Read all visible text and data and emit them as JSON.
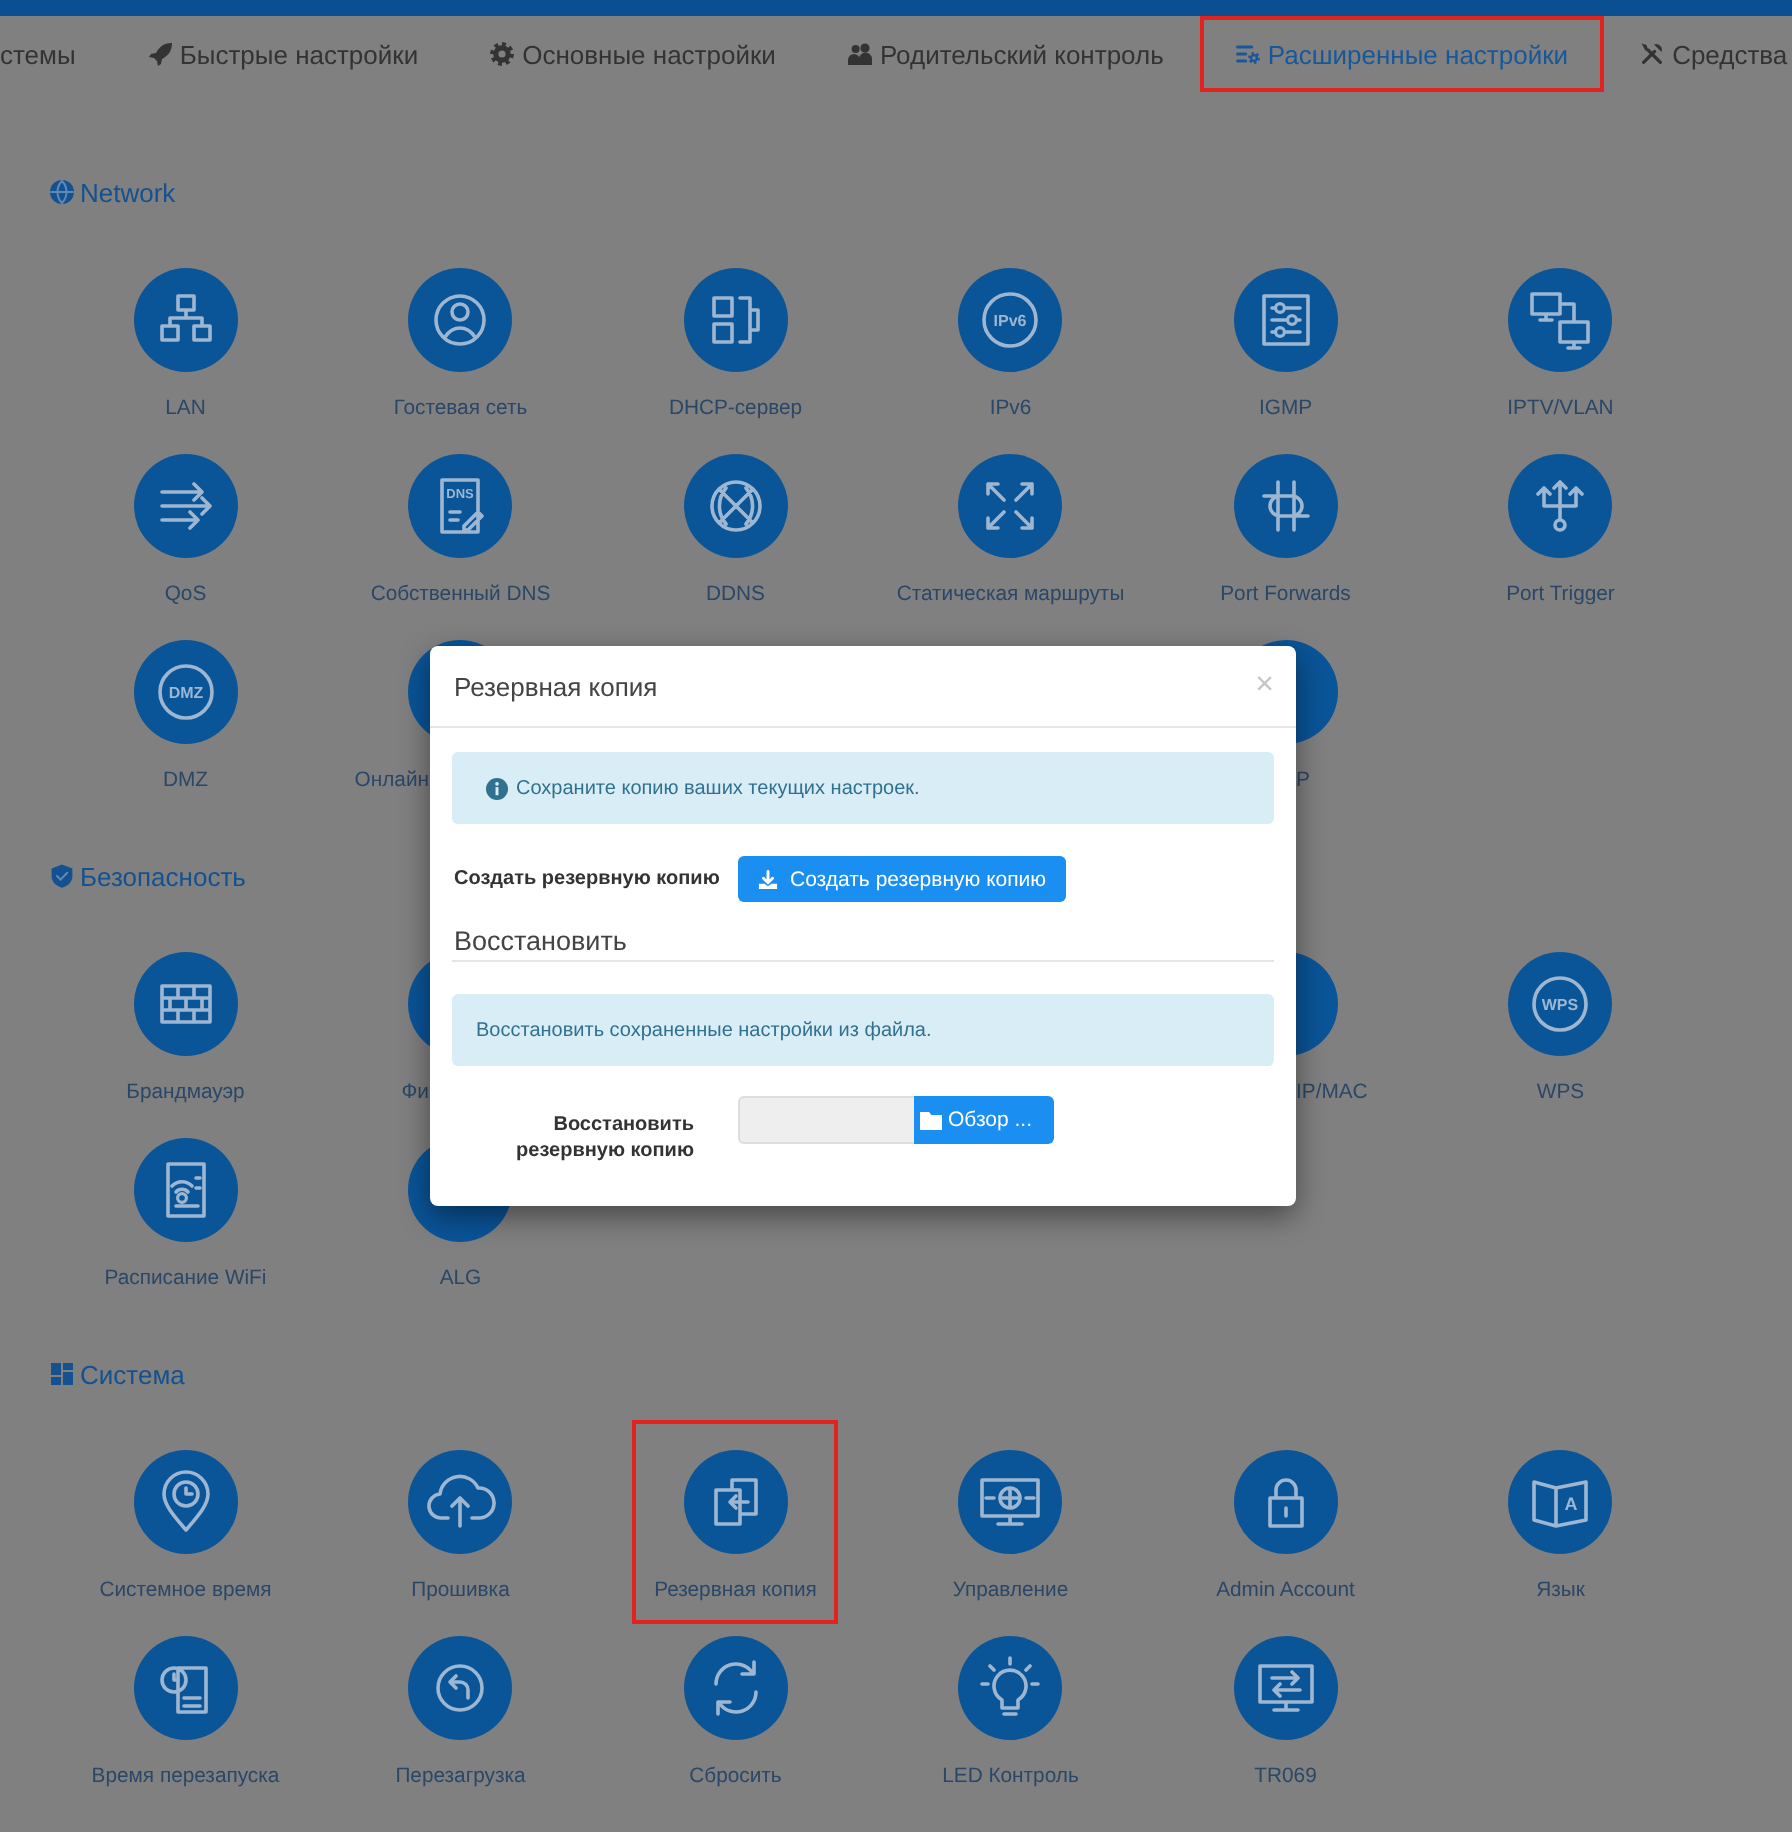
{
  "top_nav": {
    "tabs": [
      {
        "label": "стемы",
        "selected": false,
        "highlighted": false
      },
      {
        "label": "Быстрые настройки",
        "selected": false,
        "highlighted": false
      },
      {
        "label": "Основные настройки",
        "selected": false,
        "highlighted": false
      },
      {
        "label": "Родительский контроль",
        "selected": false,
        "highlighted": false
      },
      {
        "label": "Расширенные настройки",
        "selected": true,
        "highlighted": true
      },
      {
        "label": "Средства",
        "selected": false,
        "highlighted": false
      }
    ]
  },
  "sections": [
    {
      "title": "Network",
      "items": [
        {
          "kind": "full",
          "label": "LAN"
        },
        {
          "kind": "full",
          "label": "Гостевая сеть"
        },
        {
          "kind": "full",
          "label": "DHCP-сервер"
        },
        {
          "kind": "full",
          "label": "IPv6",
          "icon_text": "IPv6"
        },
        {
          "kind": "full",
          "label": "IGMP"
        },
        {
          "kind": "full",
          "label": "IPTV/VLAN"
        },
        {
          "kind": "full",
          "label": "QoS"
        },
        {
          "kind": "full",
          "label": "Собственный DNS",
          "icon_text": "DNS"
        },
        {
          "kind": "full",
          "label": "DDNS"
        },
        {
          "kind": "full",
          "label": "Статическая маршруты"
        },
        {
          "kind": "full",
          "label": "Port Forwards"
        },
        {
          "kind": "full",
          "label": "Port Trigger"
        },
        {
          "kind": "full",
          "label": "DMZ",
          "icon_text": "DMZ"
        },
        {
          "kind": "left-part",
          "label": "Онлайн"
        },
        {
          "kind": "right-part",
          "label": "P"
        }
      ]
    },
    {
      "title": "Безопасность",
      "items": [
        {
          "kind": "full",
          "label": "Брандмауэр"
        },
        {
          "kind": "left-part",
          "label": "Фи"
        },
        {
          "kind": "right-part",
          "label": "IP/MAC"
        },
        {
          "kind": "full",
          "label": "WPS",
          "icon_text": "WPS"
        },
        {
          "kind": "full",
          "label": "Расписание WiFi"
        },
        {
          "kind": "full",
          "label": "ALG"
        }
      ]
    },
    {
      "title": "Система",
      "items": [
        {
          "kind": "full",
          "label": "Системное время",
          "highlighted": false
        },
        {
          "kind": "full",
          "label": "Прошивка",
          "highlighted": false
        },
        {
          "kind": "full",
          "label": "Резервная копия",
          "highlighted": true
        },
        {
          "kind": "full",
          "label": "Управление",
          "highlighted": false
        },
        {
          "kind": "full",
          "label": "Admin Account",
          "highlighted": false
        },
        {
          "kind": "full",
          "label": "Язык",
          "icon_text": "A",
          "highlighted": false
        },
        {
          "kind": "full",
          "label": "Время перезапуска",
          "highlighted": false
        },
        {
          "kind": "full",
          "label": "Перезагрузка",
          "highlighted": false
        },
        {
          "kind": "full",
          "label": "Сбросить",
          "highlighted": false
        },
        {
          "kind": "full",
          "label": "LED Контроль",
          "highlighted": false
        },
        {
          "kind": "full",
          "label": "TR069",
          "highlighted": false
        }
      ]
    }
  ],
  "modal": {
    "title": "Резервная копия",
    "close": "×",
    "info": "Сохраните копию ваших текущих настроек.",
    "backup_label": "Создать резервную копию",
    "backup_button": "Создать резервную копию",
    "restore_heading": "Восстановить",
    "restore_info": "Восстановить сохраненные настройки из файла.",
    "restore_label": "Восстановить резервную копию",
    "browse_button": "Обзор ..."
  }
}
